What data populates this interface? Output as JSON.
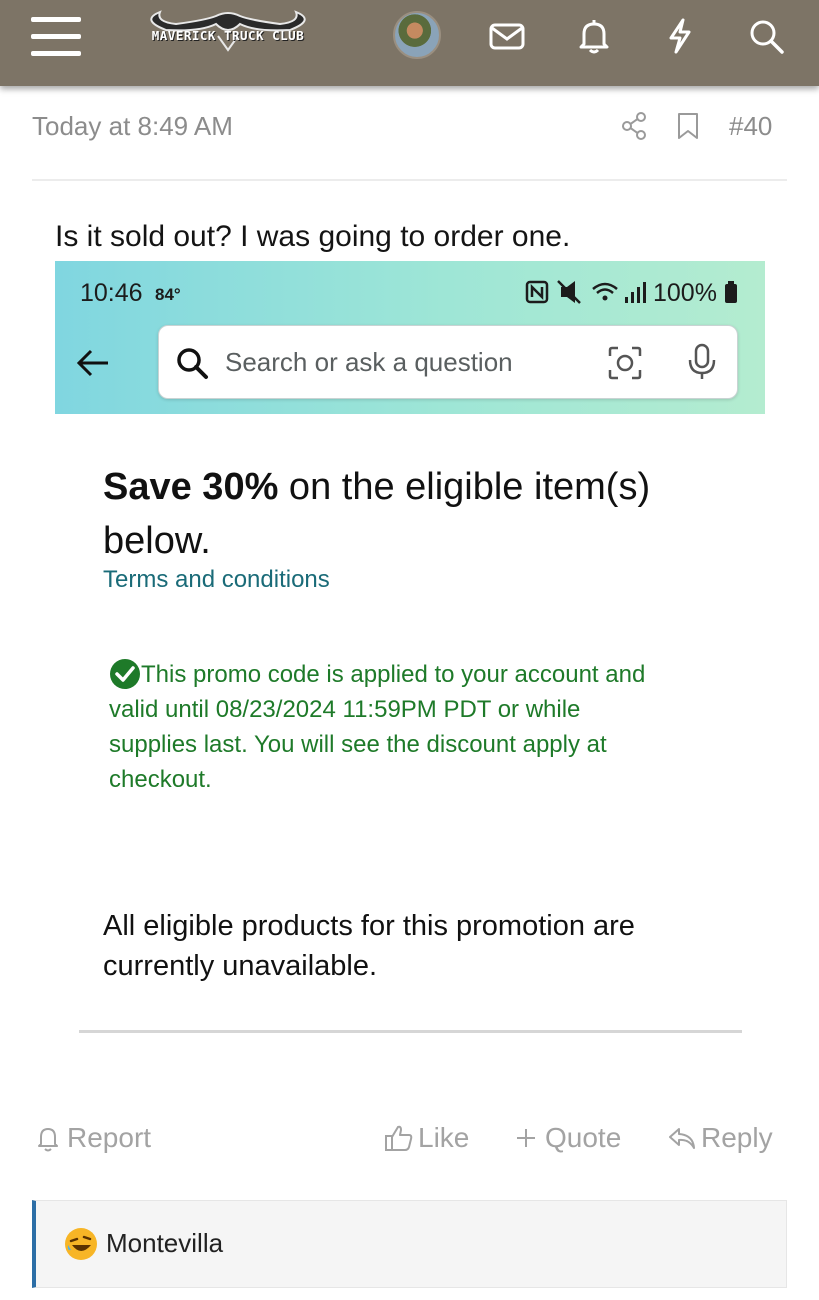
{
  "header": {
    "logo_text": "MAVERICK TRUCK CLUB",
    "icons": [
      "menu-icon",
      "envelope-icon",
      "bell-icon",
      "lightning-icon",
      "search-icon"
    ]
  },
  "post": {
    "timestamp": "Today at 8:49 AM",
    "number": "#40",
    "text": "Is it sold out? I was going to order one."
  },
  "embedded_screenshot": {
    "status_bar": {
      "time": "10:46",
      "temperature": "84°",
      "battery": "100%"
    },
    "search": {
      "placeholder": "Search or ask a question"
    },
    "promo": {
      "title_bold": "Save 30%",
      "title_rest": " on the eligible item(s) below.",
      "terms_link": "Terms and conditions",
      "notice_lines": [
        "This promo code is applied to your account and",
        "valid until 08/23/2024 11:59PM PDT or while",
        "supplies last. You will see the discount apply at",
        "checkout."
      ],
      "unavailable_text": "All eligible products for this promotion are currently unavailable."
    },
    "colors": {
      "notice_green": "#1e7a29",
      "link_teal": "#1a6b78"
    }
  },
  "actions": {
    "report": "Report",
    "like": "Like",
    "quote": "Quote",
    "reply": "Reply"
  },
  "reactions": {
    "user": "Montevilla"
  },
  "colors": {
    "header_bg": "#7d7466",
    "reaction_accent": "#2c6ea6"
  }
}
